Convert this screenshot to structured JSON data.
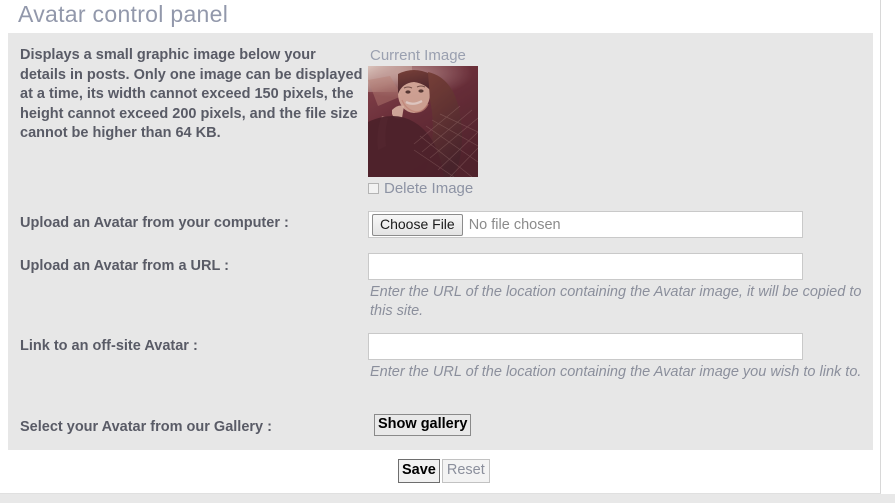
{
  "page": {
    "title": "Avatar control panel"
  },
  "description": "Displays a small graphic image below your details in posts. Only one image can be displayed at a time, its width cannot exceed 150 pixels, the height cannot exceed 200 pixels, and the file size cannot be higher than 64 KB.",
  "current_image": {
    "label": "Current Image",
    "delete_label": "Delete Image",
    "delete_checked": false
  },
  "rows": [
    {
      "label": "Upload an Avatar from your computer :",
      "button_label": "Choose File",
      "file_status": "No file chosen"
    },
    {
      "label": "Upload an Avatar from a URL :",
      "value": "",
      "placeholder": "",
      "hint": "Enter the URL of the location containing the Avatar image, it will be copied to this site."
    },
    {
      "label": "Link to an off-site Avatar :",
      "value": "",
      "placeholder": "",
      "hint": "Enter the URL of the location containing the Avatar image you wish to link to."
    },
    {
      "label": "Select your Avatar from our Gallery :",
      "button_label": "Show gallery"
    }
  ],
  "actions": {
    "save_label": "Save",
    "reset_label": "Reset"
  },
  "colors": {
    "panel_background": "#e7e7e7",
    "title_text": "#9298ab",
    "label_text": "#595b66",
    "hint_text": "#8b8f9c",
    "avatar_dominant": "#5a2631"
  }
}
